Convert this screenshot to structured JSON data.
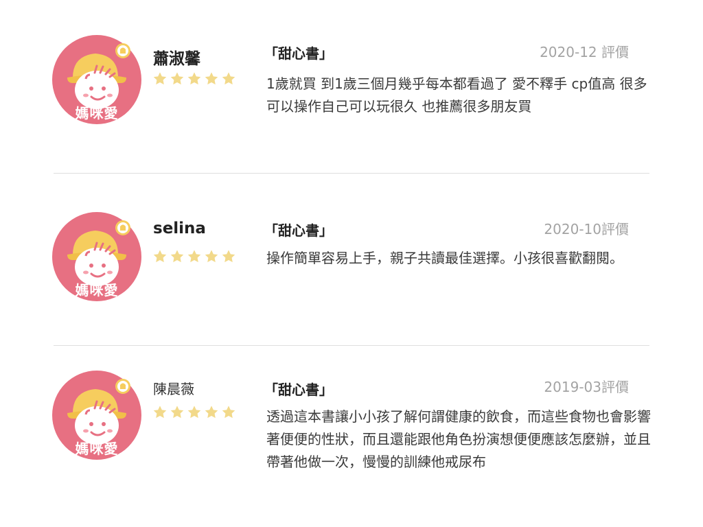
{
  "reviews": [
    {
      "avatar_text": "媽咪愛",
      "avatar_icon": "baby-face-icon",
      "name": "蕭淑馨",
      "stars": 5,
      "book": "「甜心書」",
      "date": "2020-12 評價",
      "text": "1歲就買 到1歲三個月幾乎每本都看過了 愛不釋手 cp值高  很多可以操作自己可以玩很久  也推薦很多朋友買"
    },
    {
      "avatar_text": "媽咪愛",
      "avatar_icon": "baby-face-icon",
      "name": "selina",
      "stars": 5,
      "book": "「甜心書」",
      "date": "2020-10評價",
      "text": "操作簡單容易上手，親子共讀最佳選擇。小孩很喜歡翻閱。"
    },
    {
      "avatar_text": "媽咪愛",
      "avatar_icon": "baby-face-icon",
      "name": "陳晨薇",
      "stars": 5,
      "book": "「甜心書」",
      "date": "2019-03評價",
      "text": "透過這本書讓小小孩了解何謂健康的飲食，而這些食物也會影響著便便的性狀，而且還能跟他角色扮演想便便應該怎麼辦，並且帶著他做一次，慢慢的訓練他戒尿布"
    }
  ],
  "colors": {
    "avatar_bg": "#e77082",
    "hat": "#f6cd5e",
    "star": "#f2d98a",
    "date": "#a3a3a3",
    "divider": "#dedede"
  }
}
